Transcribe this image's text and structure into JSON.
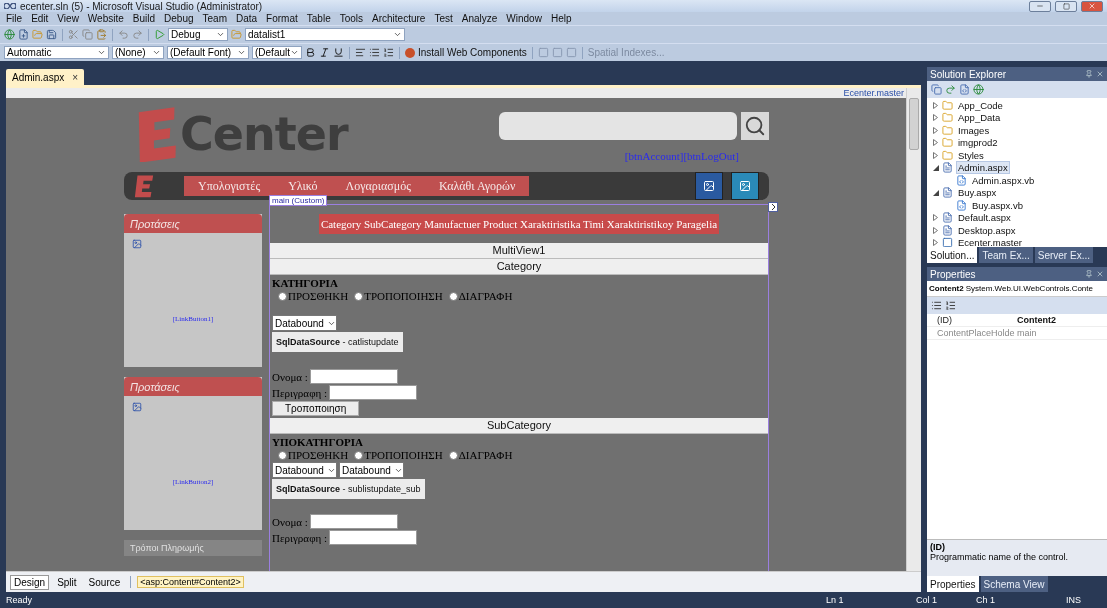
{
  "window": {
    "title": "ecenter.sln (5) - Microsoft Visual Studio (Administrator)"
  },
  "menu": [
    "File",
    "Edit",
    "View",
    "Website",
    "Build",
    "Debug",
    "Team",
    "Data",
    "Format",
    "Table",
    "Tools",
    "Architecture",
    "Test",
    "Analyze",
    "Window",
    "Help"
  ],
  "toolbar1": {
    "configuration": "Debug",
    "find": "datalist1"
  },
  "toolbar2": {
    "block_format": "Automatic",
    "style": "(None)",
    "font": "(Default Font)",
    "size": "(Default",
    "install": "Install Web Components",
    "spatial": "Spatial Indexes..."
  },
  "document_tab": {
    "label": "Admin.aspx",
    "close": "×"
  },
  "designer": {
    "master_label": "Ecenter.master",
    "logo": "Center",
    "account_links": "[btnAccount][btnLogOut]",
    "nav": [
      "Υπολογιστές",
      "Υλικό",
      "Λογαριασμός",
      "Καλάθι Αγορών"
    ],
    "content_tag": "main (Custom)",
    "banner": "Category SubCategory Manufactuer Product Xaraktiristika Timi Xaraktiristikoy Paragelia",
    "multiview": "MultiView1",
    "sidebar": [
      {
        "title": "Προτάσεις",
        "link": "[LinkButton1]"
      },
      {
        "title": "Προτάσεις",
        "link": "[LinkButton2]"
      }
    ],
    "sidebar_footer": "Τρόποι Πληρωμής",
    "sections": [
      {
        "title": "Category",
        "heading": "ΚΑΤΗΓΟΡΙΑ",
        "options": [
          {
            "label": "ΠΡΟΣΘΗΚΗ",
            "checked": false
          },
          {
            "label": "ΤΡΟΠΟΠΟΙΗΣΗ",
            "checked": false
          },
          {
            "label": "ΔΙΑΓΡΑΦΗ",
            "checked": false
          }
        ],
        "dropdowns": [
          "Databound"
        ],
        "datasource": {
          "type": "SqlDataSource",
          "name": " - catlistupdate"
        },
        "fields": [
          "Ονομα :",
          "Περιγραφη :"
        ],
        "button": "Τροποποιηση"
      },
      {
        "title": "SubCategory",
        "heading": "ΥΠΟΚΑΤΗΓΟΡΙΑ",
        "options": [
          {
            "label": "ΠΡΟΣΘΗΚΗ",
            "checked": false
          },
          {
            "label": "ΤΡΟΠΟΠΟΙΗΣΗ",
            "checked": false
          },
          {
            "label": "ΔΙΑΓΡΑΦΗ",
            "checked": false
          }
        ],
        "dropdowns": [
          "Databound",
          "Databound"
        ],
        "datasource": {
          "type": "SqlDataSource",
          "name": " - sublistupdate_sub"
        },
        "fields": [
          "Ονομα :",
          "Περιγραφη :"
        ]
      }
    ]
  },
  "view_tabs": [
    {
      "label": "Design",
      "selected": true
    },
    {
      "label": "Split",
      "selected": false
    },
    {
      "label": "Source",
      "selected": false
    }
  ],
  "breadcrumb": "<asp:Content#Content2>",
  "solution_explorer": {
    "title": "Solution Explorer",
    "items": [
      {
        "label": "App_Code",
        "kind": "folder",
        "expanded": false,
        "selected": false
      },
      {
        "label": "App_Data",
        "kind": "folder",
        "expanded": false,
        "selected": false
      },
      {
        "label": "Images",
        "kind": "folder",
        "expanded": false,
        "selected": false
      },
      {
        "label": "imgprod2",
        "kind": "folder",
        "expanded": false,
        "selected": false
      },
      {
        "label": "Styles",
        "kind": "folder",
        "expanded": false,
        "selected": false
      },
      {
        "label": "Admin.aspx",
        "kind": "page",
        "expanded": true,
        "selected": true,
        "children": [
          {
            "label": "Admin.aspx.vb",
            "kind": "code",
            "selected": false
          }
        ]
      },
      {
        "label": "Buy.aspx",
        "kind": "page",
        "expanded": true,
        "selected": false,
        "children": [
          {
            "label": "Buy.aspx.vb",
            "kind": "code",
            "selected": false
          }
        ]
      },
      {
        "label": "Default.aspx",
        "kind": "page",
        "expanded": false,
        "selected": false
      },
      {
        "label": "Desktop.aspx",
        "kind": "page",
        "expanded": false,
        "selected": false
      },
      {
        "label": "Ecenter.master",
        "kind": "master",
        "expanded": false,
        "selected": false
      }
    ],
    "tabs": [
      {
        "label": "Solution...",
        "selected": true
      },
      {
        "label": "Team Ex...",
        "selected": false
      },
      {
        "label": "Server Ex...",
        "selected": false
      }
    ]
  },
  "properties": {
    "title": "Properties",
    "object_name": "Content2",
    "object_type": "System.Web.UI.WebControls.Conte",
    "rows": [
      {
        "name": "(ID)",
        "value": "Content2"
      },
      {
        "name": "ContentPlaceHolde",
        "value": "main"
      }
    ],
    "description_title": "(ID)",
    "description": "Programmatic name of the control.",
    "tabs": [
      {
        "label": "Properties",
        "selected": true
      },
      {
        "label": "Schema View",
        "selected": false
      }
    ]
  },
  "status_bar": {
    "message": "Ready",
    "line": "Ln 1",
    "column": "Col 1",
    "char": "Ch 1",
    "mode": "INS"
  }
}
